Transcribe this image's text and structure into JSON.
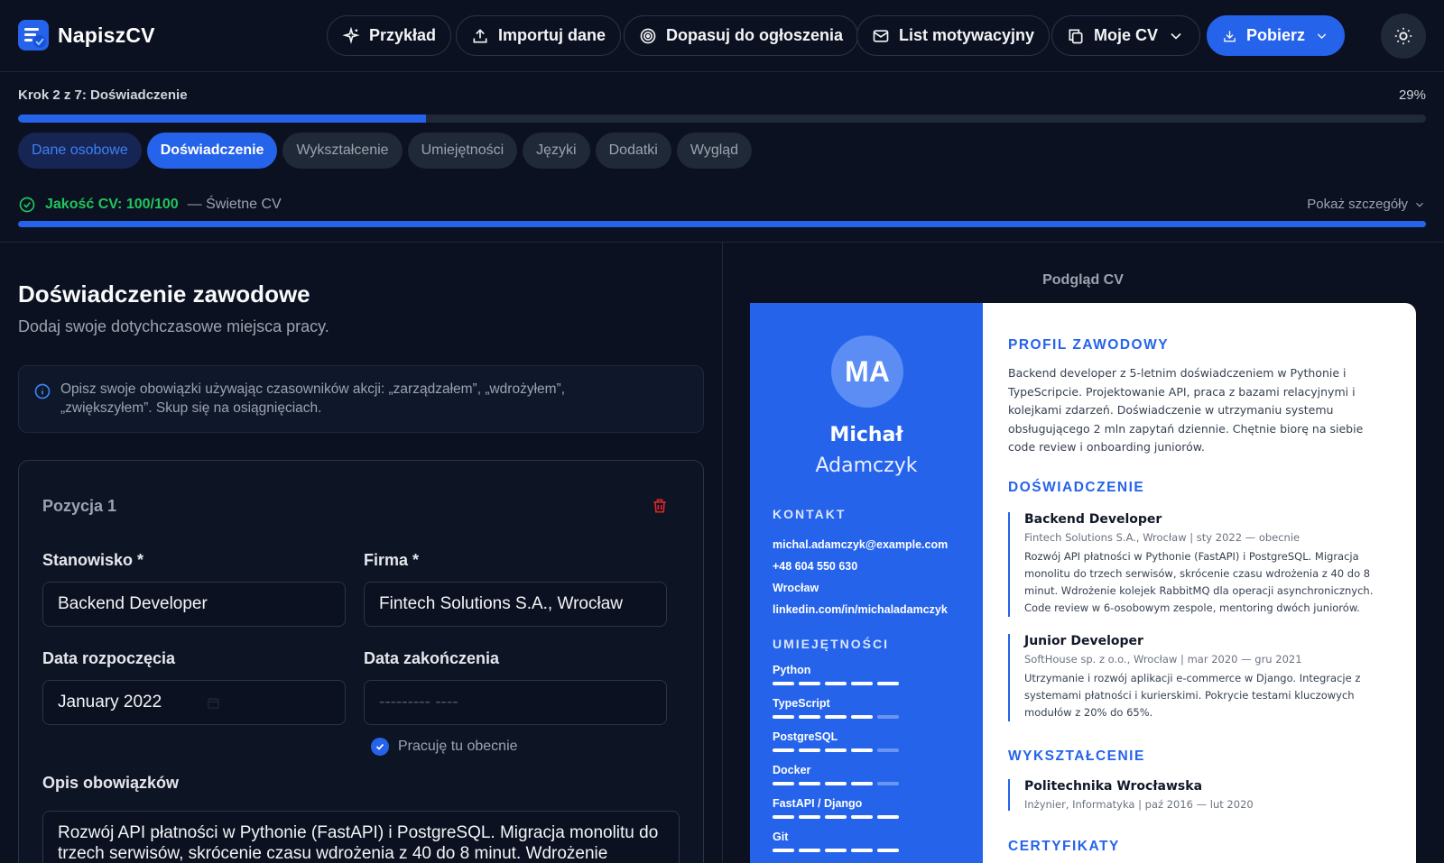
{
  "app": {
    "name": "NapiszCV"
  },
  "nav": {
    "example": "Przykład",
    "import": "Importuj dane",
    "tailor": "Dopasuj do ogłoszenia",
    "cover_letter": "List motywacyjny",
    "my_cv": "Moje CV",
    "download": "Pobierz"
  },
  "progress": {
    "label": "Krok 2 z 7: Doświadczenie",
    "percent_text": "29%",
    "fraction": 0.29
  },
  "tabs": [
    "Dane osobowe",
    "Doświadczenie",
    "Wykształcenie",
    "Umiejętności",
    "Języki",
    "Dodatki",
    "Wygląd"
  ],
  "quality": {
    "score": "Jakość CV: 100/100",
    "note": "— Świetne CV",
    "details": "Pokaż szczegóły",
    "fraction": 1.0
  },
  "form": {
    "title": "Doświadczenie zawodowe",
    "subtitle": "Dodaj swoje dotychczasowe miejsca pracy.",
    "tip": "Opisz swoje obowiązki używając czasowników akcji: „zarządzałem”, „wdrożyłem”, „zwiększyłem”. Skup się na osiągnięciach.",
    "position_title": "Pozycja 1",
    "job_label": "Stanowisko *",
    "job_value": "Backend Developer",
    "company_label": "Firma *",
    "company_value": "Fintech Solutions S.A., Wrocław",
    "start_label": "Data rozpoczęcia",
    "start_value": "January  2022",
    "end_label": "Data zakończenia",
    "end_placeholder": "---------  ----",
    "current_label": "Pracuję tu obecnie",
    "desc_label": "Opis obowiązków",
    "desc_value": "Rozwój API płatności w Pythonie (FastAPI) i PostgreSQL. Migracja monolitu do trzech serwisów, skrócenie czasu wdrożenia z 40 do 8 minut. Wdrożenie kolejek"
  },
  "preview": {
    "label": "Podgląd CV",
    "initials": "MA",
    "first_name": "Michał",
    "last_name": "Adamczyk",
    "contact_heading": "KONTAKT",
    "contact": [
      "michal.adamczyk@example.com",
      "+48 604 550 630",
      "Wrocław",
      "linkedin.com/in/michaladamczyk"
    ],
    "skills_heading": "UMIEJĘTNOŚCI",
    "skills": [
      {
        "name": "Python",
        "level": 5
      },
      {
        "name": "TypeScript",
        "level": 4
      },
      {
        "name": "PostgreSQL",
        "level": 4
      },
      {
        "name": "Docker",
        "level": 4
      },
      {
        "name": "FastAPI / Django",
        "level": 5
      },
      {
        "name": "Git",
        "level": 5
      }
    ],
    "profile_heading": "PROFIL ZAWODOWY",
    "profile_text": "Backend developer z 5-letnim doświadczeniem w Pythonie i TypeScripcie. Projektowanie API, praca z bazami relacyjnymi i kolejkami zdarzeń. Doświadczenie w utrzymaniu systemu obsługującego 2 mln zapytań dziennie. Chętnie biorę na siebie code review i onboarding juniorów.",
    "experience_heading": "DOŚWIADCZENIE",
    "jobs": [
      {
        "title": "Backend Developer",
        "meta": "Fintech Solutions S.A., Wrocław | sty 2022 — obecnie",
        "desc": "Rozwój API płatności w Pythonie (FastAPI) i PostgreSQL. Migracja monolitu do trzech serwisów, skrócenie czasu wdrożenia z 40 do 8 minut. Wdrożenie kolejek RabbitMQ dla operacji asynchronicznych. Code review w 6-osobowym zespole, mentoring dwóch juniorów."
      },
      {
        "title": "Junior Developer",
        "meta": "SoftHouse sp. z o.o., Wrocław | mar 2020 — gru 2021",
        "desc": "Utrzymanie i rozwój aplikacji e-commerce w Django. Integracje z systemami płatności i kurierskimi. Pokrycie testami kluczowych modułów z 20% do 65%."
      }
    ],
    "education_heading": "WYKSZTAŁCENIE",
    "education": {
      "school": "Politechnika Wrocławska",
      "meta": "Inżynier, Informatyka | paź 2016 — lut 2020"
    },
    "certs_heading": "CERTYFIKATY"
  },
  "colors": {
    "accent": "#2563eb",
    "success": "#22c55e",
    "background": "#0b1120",
    "danger": "#dc2626"
  }
}
